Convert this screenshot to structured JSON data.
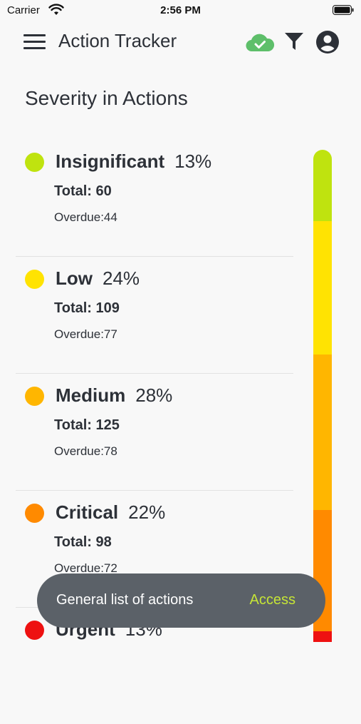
{
  "status_bar": {
    "carrier": "Carrier",
    "time": "2:56 PM"
  },
  "app_bar": {
    "title": "Action Tracker",
    "icons": [
      "menu-icon",
      "cloud-check-icon",
      "filter-icon",
      "account-circle-icon"
    ]
  },
  "section_title": "Severity in Actions",
  "severities": [
    {
      "name": "Insignificant",
      "percent": "13%",
      "total": "Total: 60",
      "overdue": "Overdue:44",
      "color": "#bfe30f"
    },
    {
      "name": "Low",
      "percent": "24%",
      "total": "Total: 109",
      "overdue": "Overdue:77",
      "color": "#ffe302"
    },
    {
      "name": "Medium",
      "percent": "28%",
      "total": "Total: 125",
      "overdue": "Overdue:78",
      "color": "#ffb600"
    },
    {
      "name": "Critical",
      "percent": "22%",
      "total": "Total: 98",
      "overdue": "Overdue:72",
      "color": "#ff8a00"
    },
    {
      "name": "Urgent",
      "percent": "13%",
      "total": "",
      "overdue": "",
      "color": "#ee1111"
    }
  ],
  "snackbar": {
    "message": "General list of actions",
    "action": "Access",
    "action_color": "#c6e536"
  },
  "colors": {
    "cloud": "#5ebf6a",
    "text": "#2d3138"
  }
}
